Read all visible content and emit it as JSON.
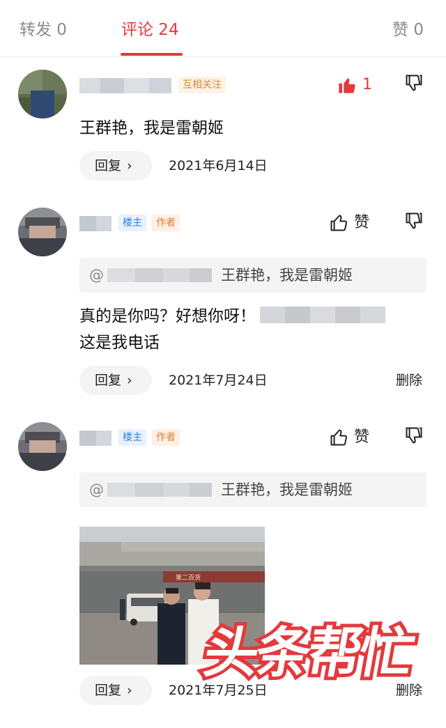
{
  "tabs": [
    {
      "label": "转发 0"
    },
    {
      "label": "评论 24"
    },
    {
      "label": "赞 0"
    }
  ],
  "colors": {
    "accent": "#e4393c",
    "badge_op": "#2f7fd9",
    "badge_author": "#e07b30",
    "badge_mutual": "#d28a2c"
  },
  "comments": [
    {
      "badges": [
        "互相关注"
      ],
      "like_count": "1",
      "liked": true,
      "text": "王群艳，我是雷朝姬",
      "reply_label": "回复",
      "date": "2021年6月14日"
    },
    {
      "badges": [
        "楼主",
        "作者"
      ],
      "like_label": "赞",
      "quote_at": "@",
      "quote_text": "王群艳，我是雷朝姬",
      "text_line1": "真的是你吗？好想你呀！",
      "text_line2": "这是我电话",
      "reply_label": "回复",
      "date": "2021年7月24日",
      "delete_label": "删除"
    },
    {
      "badges": [
        "楼主",
        "作者"
      ],
      "like_label": "赞",
      "quote_at": "@",
      "quote_text": "王群艳，我是雷朝姬",
      "photo_banner": "第二百货",
      "reply_label": "回复",
      "date": "2021年7月25日",
      "delete_label": "删除"
    }
  ],
  "watermark": {
    "text": "头条帮忙"
  },
  "icons": [
    "thumb-up-filled-icon",
    "thumb-up-outline-icon",
    "thumb-down-icon",
    "chevron-right-icon"
  ]
}
